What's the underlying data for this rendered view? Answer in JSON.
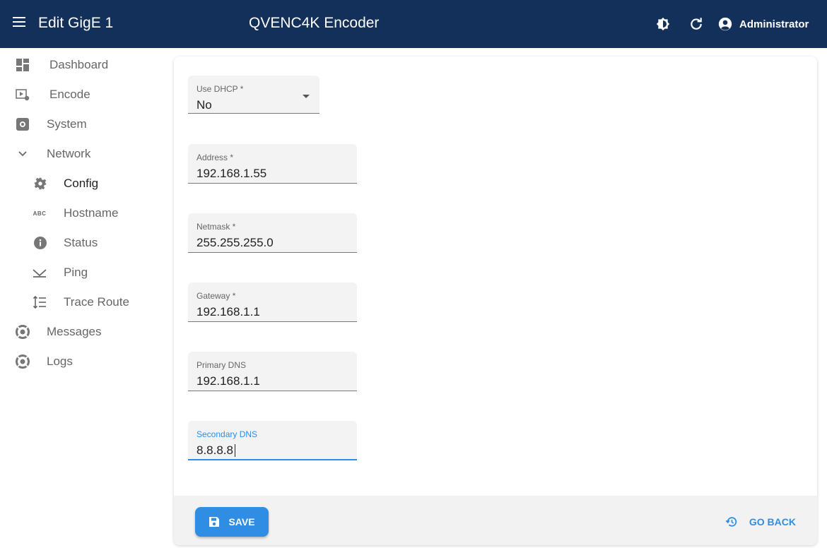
{
  "header": {
    "page_title": "Edit GigE 1",
    "app_title": "QVENC4K Encoder",
    "user_name": "Administrator"
  },
  "sidebar": {
    "items": [
      {
        "label": "Dashboard",
        "icon": "dashboard-icon"
      },
      {
        "label": "Encode",
        "icon": "encode-icon"
      },
      {
        "label": "System",
        "icon": "system-icon"
      },
      {
        "label": "Network",
        "icon": "chevron-down-icon",
        "expanded": true
      },
      {
        "label": "Config",
        "icon": "gear-icon",
        "active": true
      },
      {
        "label": "Hostname",
        "icon": "abc-icon"
      },
      {
        "label": "Status",
        "icon": "info-icon"
      },
      {
        "label": "Ping",
        "icon": "ping-icon"
      },
      {
        "label": "Trace Route",
        "icon": "trace-route-icon"
      },
      {
        "label": "Messages",
        "icon": "lifebuoy-icon"
      },
      {
        "label": "Logs",
        "icon": "lifebuoy-icon"
      }
    ]
  },
  "form": {
    "dhcp": {
      "label": "Use DHCP *",
      "value": "No"
    },
    "address": {
      "label": "Address *",
      "value": "192.168.1.55"
    },
    "netmask": {
      "label": "Netmask *",
      "value": "255.255.255.0"
    },
    "gateway": {
      "label": "Gateway *",
      "value": "192.168.1.1"
    },
    "primary_dns": {
      "label": "Primary DNS",
      "value": "192.168.1.1"
    },
    "secondary_dns": {
      "label": "Secondary DNS",
      "value": "8.8.8.8"
    }
  },
  "actions": {
    "save_label": "SAVE",
    "go_back_label": "GO BACK"
  },
  "colors": {
    "appbar": "#123059",
    "accent": "#2f8de4"
  }
}
